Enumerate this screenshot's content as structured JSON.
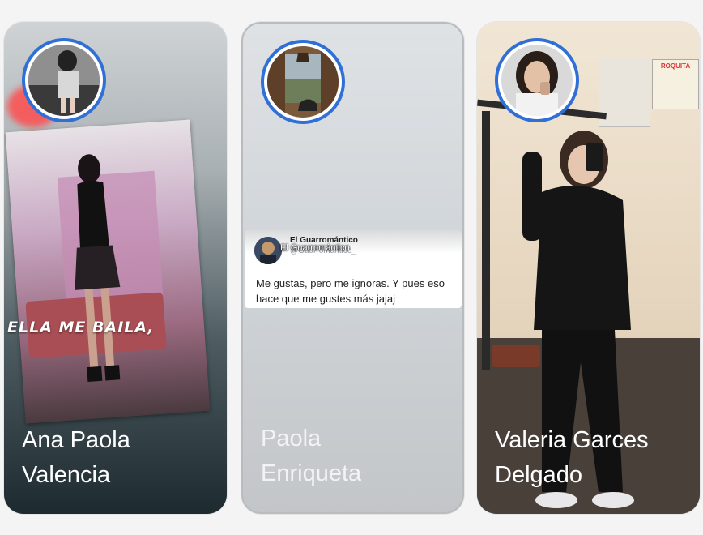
{
  "cards": [
    {
      "name_line1": "Ana Paola",
      "name_line2": "Valencia",
      "caption": "ELLA ME BAILA,"
    },
    {
      "name_line1": "Paola",
      "name_line2": "Enriqueta",
      "tweet": {
        "author": "El Guarromántico",
        "handle": "@Guarromantico_",
        "overlay_label": "El Guarromántico",
        "text": "Me gustas, pero me ignoras. Y pues eso hace que me gustes más jajaj"
      }
    },
    {
      "name_line1": "Valeria Garces",
      "name_line2": "Delgado",
      "poster_text": "ROQUITA"
    }
  ],
  "colors": {
    "avatar_ring": "#2f6fd6",
    "name_text": "#ffffff"
  }
}
